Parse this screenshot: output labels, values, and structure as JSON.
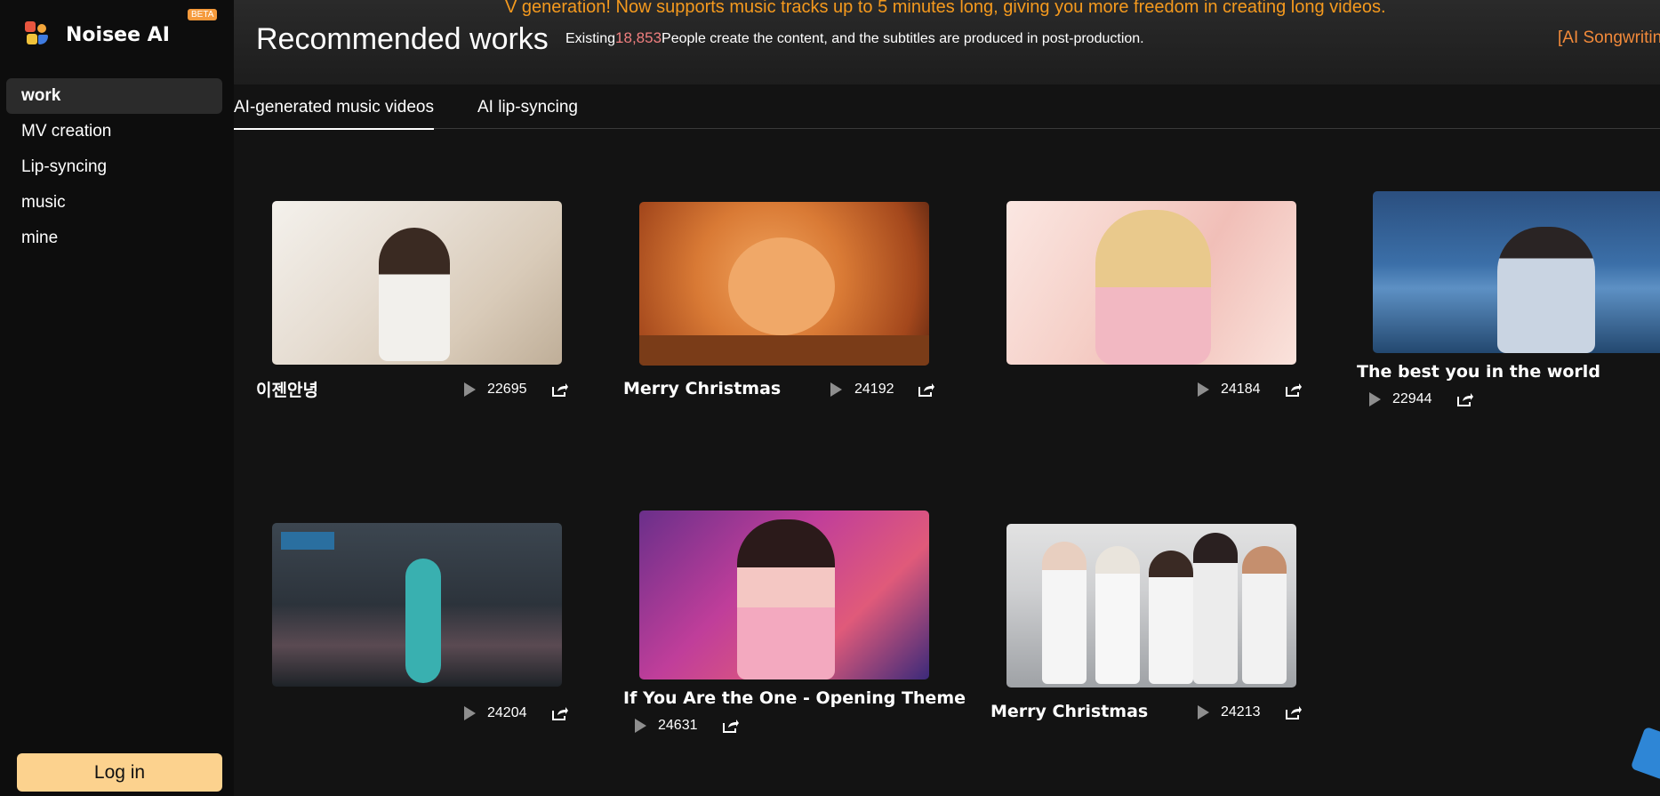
{
  "sidebar": {
    "brand_name": "Noisee AI",
    "beta_badge": "BETA",
    "nav": [
      "work",
      "MV creation",
      "Lip-syncing",
      "music",
      "mine"
    ],
    "login_label": "Log in"
  },
  "header": {
    "marquee": "V generation! Now supports music tracks up to 5 minutes long, giving you more freedom in creating long videos.",
    "page_title": "Recommended works",
    "stats_prefix": "Existing",
    "stats_count": "18,853",
    "stats_suffix": "People create the content, and the subtitles are produced in post-production.",
    "songwriting": "[AI Songwritin"
  },
  "tabs": [
    "AI-generated music videos",
    "AI lip-syncing"
  ],
  "colors": {
    "accent_orange": "#f59a1e",
    "login_bg": "#fcd28e",
    "count_pink": "#f07f7f"
  },
  "works": [
    {
      "title": "이젠안녕",
      "views": "22695"
    },
    {
      "title": "Merry Christmas",
      "views": "24192"
    },
    {
      "title": "",
      "views": "24184"
    },
    {
      "title": "The best you in the world",
      "views": "22944"
    },
    {
      "title": "",
      "views": "24204"
    },
    {
      "title": "If You Are the One - Opening Theme",
      "views": "24631"
    },
    {
      "title": "Merry Christmas",
      "views": "24213"
    }
  ]
}
